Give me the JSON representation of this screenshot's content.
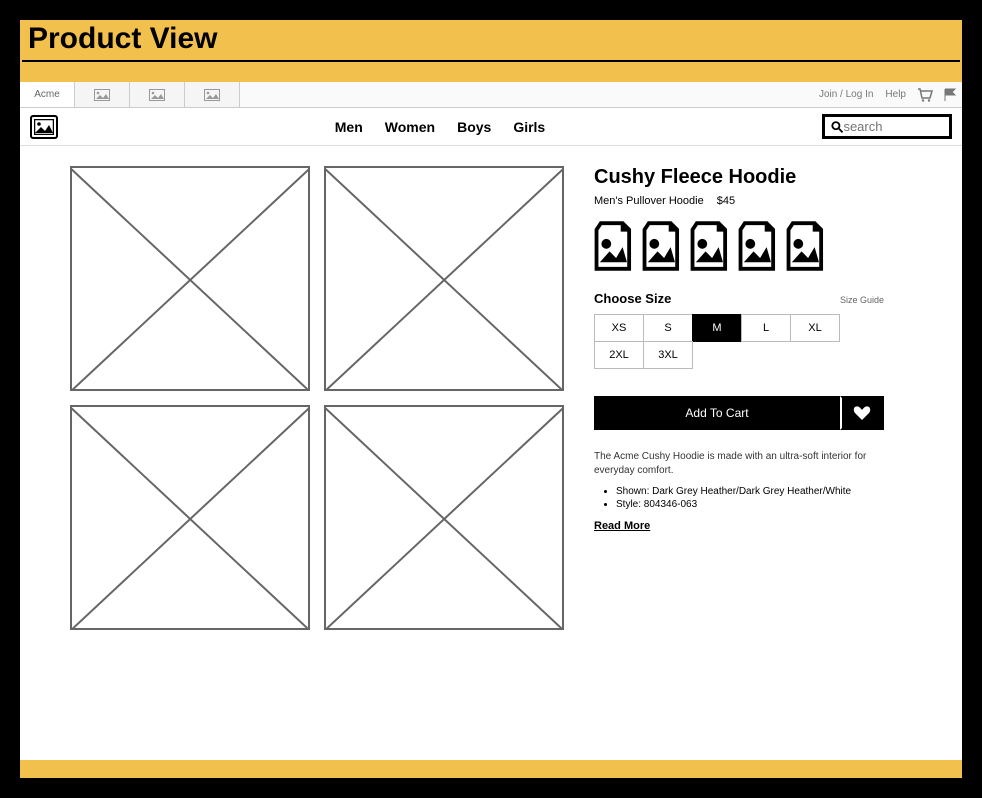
{
  "page_header": "Product View",
  "topbar": {
    "site_name": "Acme",
    "join_login": "Join / Log In",
    "help": "Help"
  },
  "nav": {
    "categories": [
      "Men",
      "Women",
      "Boys",
      "Girls"
    ]
  },
  "search": {
    "placeholder": "search"
  },
  "product": {
    "title": "Cushy Fleece Hoodie",
    "subtitle": "Men's Pullover Hoodie",
    "price": "$45",
    "size_label": "Choose Size",
    "size_guide": "Size Guide",
    "sizes": [
      "XS",
      "S",
      "M",
      "L",
      "XL",
      "2XL",
      "3XL"
    ],
    "selected_size": "M",
    "add_to_cart": "Add To Cart",
    "description": "The Acme Cushy Hoodie is made with an ultra-soft interior for everyday comfort.",
    "bullets": [
      "Shown: Dark Grey Heather/Dark Grey Heather/White",
      "Style: 804346-063"
    ],
    "read_more": "Read More"
  }
}
